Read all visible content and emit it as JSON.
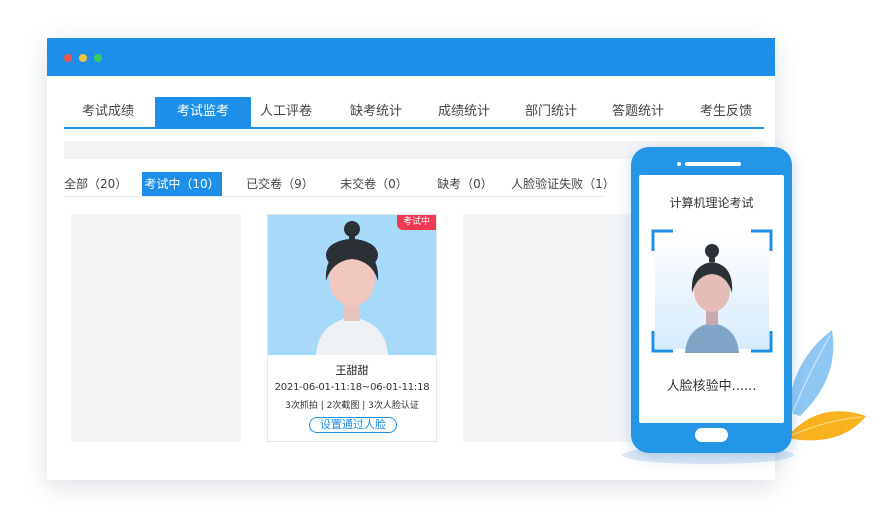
{
  "tabs": [
    {
      "label": "考试成绩",
      "active": false
    },
    {
      "label": "考试监考",
      "active": true
    },
    {
      "label": "人工评卷",
      "active": false
    },
    {
      "label": "缺考统计",
      "active": false
    },
    {
      "label": "成绩统计",
      "active": false
    },
    {
      "label": "部门统计",
      "active": false
    },
    {
      "label": "答题统计",
      "active": false
    },
    {
      "label": "考生反馈",
      "active": false
    }
  ],
  "filters": [
    {
      "label": "全部（20）",
      "active": false
    },
    {
      "label": "考试中（10）",
      "active": true
    },
    {
      "label": "已交卷（9）",
      "active": false
    },
    {
      "label": "未交卷（0）",
      "active": false
    },
    {
      "label": "缺考（0）",
      "active": false
    },
    {
      "label": "人脸验证失败（1）",
      "active": false
    }
  ],
  "card": {
    "badge": "考试中",
    "name": "王甜甜",
    "time": "2021-06-01-11:18~06-01-11:18",
    "stats": "3次抓拍 | 2次截图 | 3次人脸认证",
    "button": "设置通过人脸"
  },
  "phone": {
    "title": "计算机理论考试",
    "status": "人脸核验中......"
  },
  "colors": {
    "primary": "#1e8fe8",
    "badge": "#ee3950",
    "photo_bg": "#a6d9fa"
  }
}
